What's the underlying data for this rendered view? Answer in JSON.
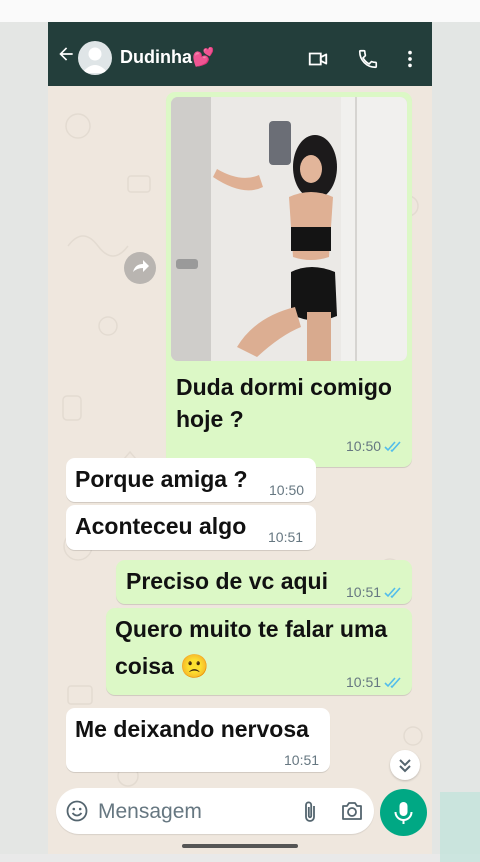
{
  "header": {
    "contact_name": "Dudinha💕"
  },
  "messages": [
    {
      "direction": "outgoing",
      "type": "image",
      "caption": [
        "Duda dormi comigo",
        "hoje ?"
      ],
      "time": "10:50",
      "status": "read"
    },
    {
      "direction": "incoming",
      "text": "Porque amiga ?",
      "time": "10:50"
    },
    {
      "direction": "incoming",
      "text": "Aconteceu algo",
      "time": "10:51"
    },
    {
      "direction": "outgoing",
      "text": "Preciso de vc aqui",
      "time": "10:51",
      "status": "read"
    },
    {
      "direction": "outgoing",
      "text_lines": [
        "Quero muito te falar uma",
        "coisa 🙁"
      ],
      "time": "10:51",
      "status": "read"
    },
    {
      "direction": "incoming",
      "text": "Me deixando nervosa",
      "time": "10:51"
    }
  ],
  "composer": {
    "placeholder": "Mensagem"
  },
  "colors": {
    "header_bg": "#233e3b",
    "outgoing_bubble": "#dcf8c6",
    "incoming_bubble": "#ffffff",
    "chat_bg": "#efe7de",
    "read_ticks": "#53bdeb",
    "mic_button": "#00a884"
  },
  "icons": [
    "back-arrow-icon",
    "video-call-icon",
    "phone-icon",
    "more-vert-icon",
    "forward-icon",
    "chevron-down-icon",
    "emoji-icon",
    "attach-icon",
    "camera-icon",
    "mic-icon",
    "double-check-icon"
  ]
}
